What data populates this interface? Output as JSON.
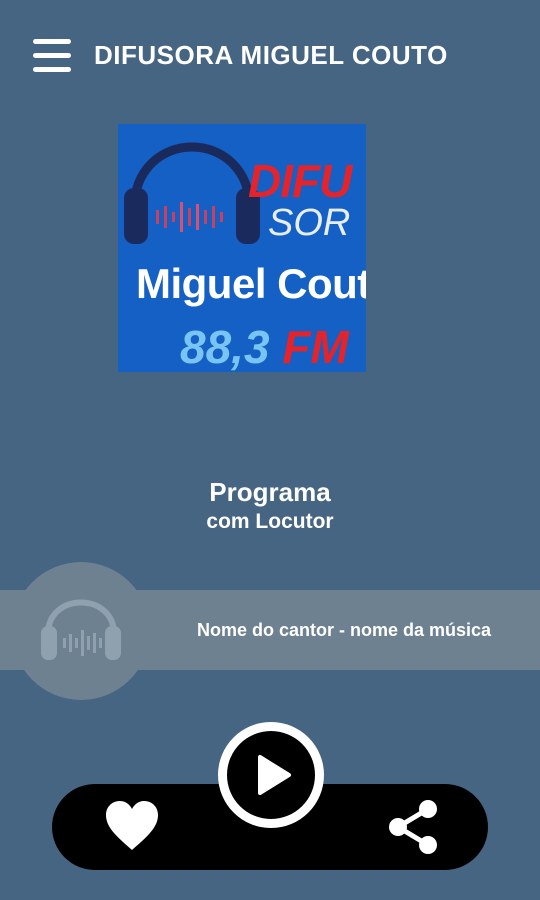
{
  "header": {
    "title": "DIFUSORA MIGUEL COUTO",
    "menu_icon": "hamburger-menu-icon"
  },
  "logo": {
    "line1": "DIFU",
    "line2": "SOR",
    "line3": "Miguel Cout",
    "frequency_number": "88,3",
    "frequency_unit": "FM",
    "colors": {
      "background": "#1460c5",
      "red": "#e5232a",
      "light_blue": "#78c4f4"
    }
  },
  "program": {
    "title": "Programa",
    "host": "com Locutor"
  },
  "now_playing": {
    "text": "Nome do cantor - nome da música",
    "icon": "headphones-icon"
  },
  "controls": {
    "favorite_icon": "heart-icon",
    "play_icon": "play-icon",
    "share_icon": "share-icon"
  },
  "colors": {
    "background": "#456582",
    "now_playing_bar": "#6d8191",
    "controls_bar": "#000000"
  }
}
